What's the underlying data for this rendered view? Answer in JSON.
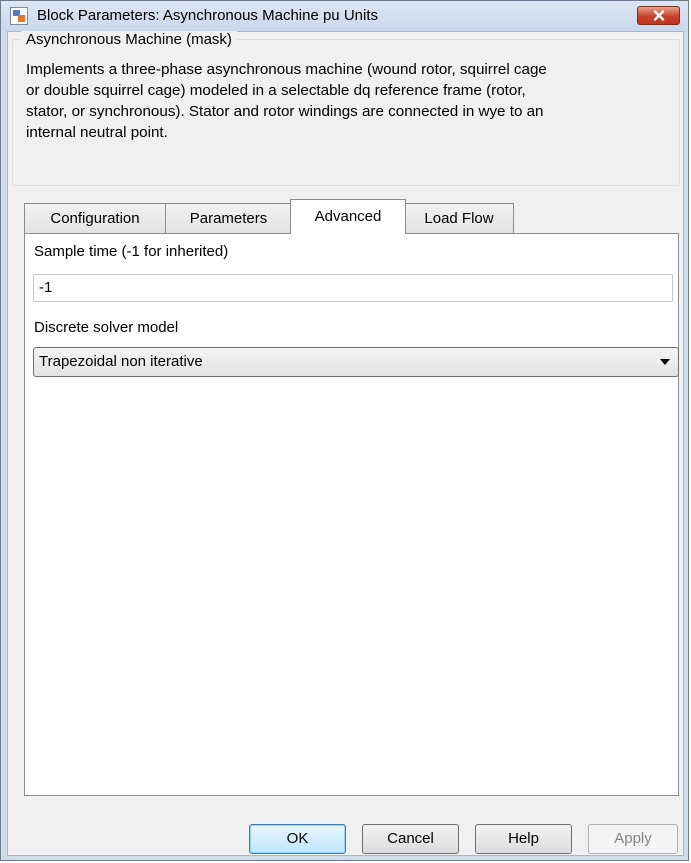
{
  "window": {
    "title": "Block Parameters: Asynchronous Machine pu Units",
    "close_glyph": "×"
  },
  "mask": {
    "legend": "Asynchronous Machine (mask)",
    "description_lines": [
      "Implements a three-phase asynchronous machine (wound rotor, squirrel cage",
      "or double squirrel cage) modeled in a selectable dq reference frame (rotor,",
      "stator, or synchronous). Stator and rotor windings are connected in wye to an",
      "internal neutral point."
    ]
  },
  "tabs": [
    {
      "label": "Configuration",
      "active": false
    },
    {
      "label": "Parameters",
      "active": false
    },
    {
      "label": "Advanced",
      "active": true
    },
    {
      "label": "Load Flow",
      "active": false
    }
  ],
  "advanced": {
    "sample_time_label": "Sample time (-1 for inherited)",
    "sample_time_value": "-1",
    "solver_label": "Discrete solver model",
    "solver_value": "Trapezoidal non iterative"
  },
  "buttons": {
    "ok": "OK",
    "cancel": "Cancel",
    "help": "Help",
    "apply": "Apply"
  },
  "colors": {
    "window_frame": "#cfdcec",
    "client_bg": "#f0f0f0",
    "close_button": "#c8402a",
    "default_button_border": "#3c7fb1"
  }
}
